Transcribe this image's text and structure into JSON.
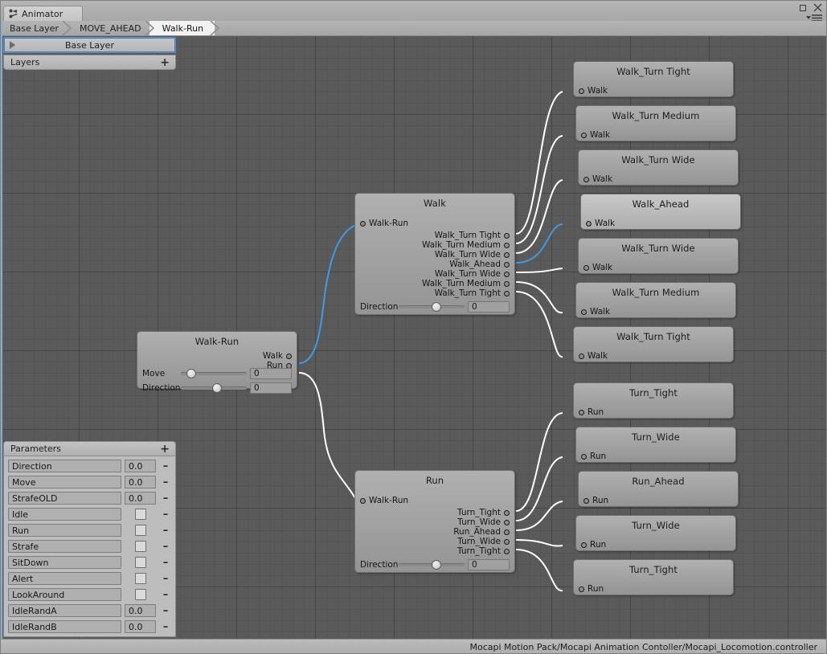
{
  "window": {
    "tab_label": "Animator",
    "tab_icon": "animator-graph-icon",
    "maximize_icon": "maximize-icon",
    "close_icon": "close-icon",
    "menu_icon": "panel-menu-icon"
  },
  "breadcrumb": {
    "items": [
      {
        "label": "Base Layer",
        "active": false
      },
      {
        "label": "MOVE_AHEAD",
        "active": false
      },
      {
        "label": "Walk-Run",
        "active": true
      }
    ]
  },
  "layers": {
    "selected_layer": "Base Layer",
    "panel_title": "Layers",
    "add_label": "+",
    "foldout_icon": "triangle-right-icon"
  },
  "parameters": {
    "panel_title": "Parameters",
    "add_label": "+",
    "remove_label": "–",
    "rows": [
      {
        "name": "Direction",
        "type": "float",
        "value": "0.0"
      },
      {
        "name": "Move",
        "type": "float",
        "value": "0.0"
      },
      {
        "name": "StrafeOLD",
        "type": "float",
        "value": "0.0"
      },
      {
        "name": "Idle",
        "type": "bool",
        "value": false
      },
      {
        "name": "Run",
        "type": "bool",
        "value": false
      },
      {
        "name": "Strafe",
        "type": "bool",
        "value": false
      },
      {
        "name": "SitDown",
        "type": "bool",
        "value": false
      },
      {
        "name": "Alert",
        "type": "bool",
        "value": false
      },
      {
        "name": "LookAround",
        "type": "bool",
        "value": false
      },
      {
        "name": "IdleRandA",
        "type": "float",
        "value": "0.0"
      },
      {
        "name": "IdleRandB",
        "type": "float",
        "value": "0.0"
      }
    ]
  },
  "graph": {
    "nodes": [
      {
        "id": "walkrun",
        "title": "Walk-Run",
        "selected": false,
        "inputs": [],
        "outputs": [
          "Walk",
          "Run"
        ],
        "sliders": [
          {
            "label": "Move",
            "value": "0",
            "knob_pct": 8
          },
          {
            "label": "Direction",
            "value": "0",
            "knob_pct": 48
          }
        ]
      },
      {
        "id": "walk",
        "title": "Walk",
        "selected": false,
        "inputs": [
          "Walk-Run"
        ],
        "outputs": [
          "Walk_Turn Tight",
          "Walk_Turn Medium",
          "Walk_Turn Wide",
          "Walk_Ahead",
          "Walk_Turn Wide",
          "Walk_Turn Medium",
          "Walk_Turn Tight"
        ],
        "sliders": [
          {
            "label": "Direction",
            "value": "0",
            "knob_pct": 50
          }
        ]
      },
      {
        "id": "run",
        "title": "Run",
        "selected": false,
        "inputs": [
          "Walk-Run"
        ],
        "outputs": [
          "Turn_Tight",
          "Turn_Wide",
          "Run_Ahead",
          "Turn_Wide",
          "Turn_Tight"
        ],
        "sliders": [
          {
            "label": "Direction",
            "value": "0",
            "knob_pct": 50
          }
        ]
      },
      {
        "id": "wtt1",
        "title": "Walk_Turn Tight",
        "selected": false,
        "inputs": [
          "Walk"
        ],
        "outputs": [],
        "sliders": []
      },
      {
        "id": "wtm1",
        "title": "Walk_Turn Medium",
        "selected": false,
        "inputs": [
          "Walk"
        ],
        "outputs": [],
        "sliders": []
      },
      {
        "id": "wtw1",
        "title": "Walk_Turn Wide",
        "selected": false,
        "inputs": [
          "Walk"
        ],
        "outputs": [],
        "sliders": []
      },
      {
        "id": "wa",
        "title": "Walk_Ahead",
        "selected": true,
        "inputs": [
          "Walk"
        ],
        "outputs": [],
        "sliders": []
      },
      {
        "id": "wtw2",
        "title": "Walk_Turn Wide",
        "selected": false,
        "inputs": [
          "Walk"
        ],
        "outputs": [],
        "sliders": []
      },
      {
        "id": "wtm2",
        "title": "Walk_Turn Medium",
        "selected": false,
        "inputs": [
          "Walk"
        ],
        "outputs": [],
        "sliders": []
      },
      {
        "id": "wtt2",
        "title": "Walk_Turn Tight",
        "selected": false,
        "inputs": [
          "Walk"
        ],
        "outputs": [],
        "sliders": []
      },
      {
        "id": "rtt1",
        "title": "Turn_Tight",
        "selected": false,
        "inputs": [
          "Run"
        ],
        "outputs": [],
        "sliders": []
      },
      {
        "id": "rtw1",
        "title": "Turn_Wide",
        "selected": false,
        "inputs": [
          "Run"
        ],
        "outputs": [],
        "sliders": []
      },
      {
        "id": "ra",
        "title": "Run_Ahead",
        "selected": false,
        "inputs": [
          "Run"
        ],
        "outputs": [],
        "sliders": []
      },
      {
        "id": "rtw2",
        "title": "Turn_Wide",
        "selected": false,
        "inputs": [
          "Run"
        ],
        "outputs": [],
        "sliders": []
      },
      {
        "id": "rtt2",
        "title": "Turn_Tight",
        "selected": false,
        "inputs": [
          "Run"
        ],
        "outputs": [],
        "sliders": []
      }
    ],
    "edge_color": "#ffffff",
    "edge_color_highlight": "#3d9ce8"
  },
  "statusbar": {
    "asset_path": "Mocapi Motion Pack/Mocapi Animation Contoller/Mocapi_Locomotion.controller"
  },
  "colors": {
    "canvas_bg": "#5a5a5a",
    "chrome_bg": "#aeaeae",
    "node_bg": "#a2a2a2",
    "selection_blue": "#5b8fc9",
    "accent_blue": "#3d9ce8"
  }
}
